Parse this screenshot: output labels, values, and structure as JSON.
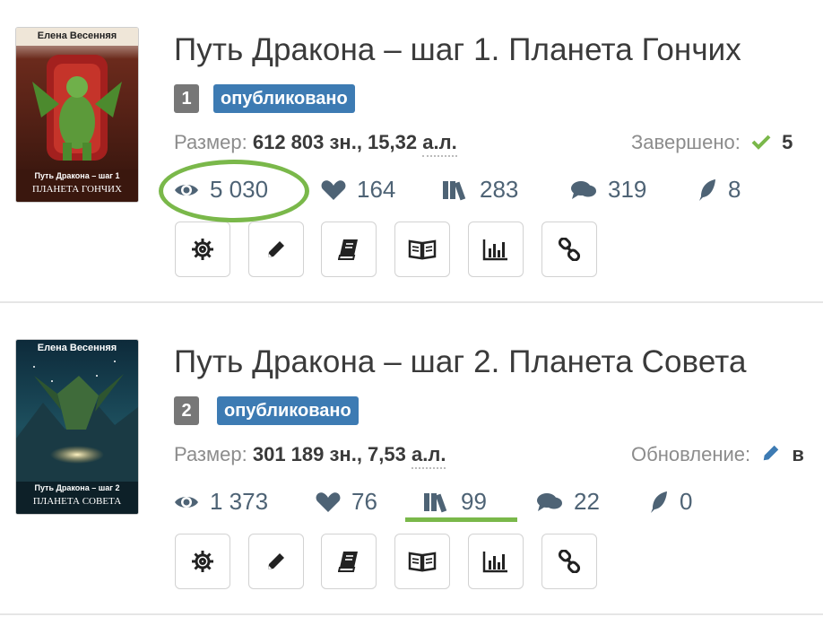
{
  "books": [
    {
      "cover": {
        "author": "Елена Весенняя",
        "subtitle": "Путь Дракона – шаг 1",
        "name": "ПЛАНЕТА ГОНЧИХ"
      },
      "title": "Путь Дракона – шаг 1. Планета Гончих",
      "number": "1",
      "status": "опубликовано",
      "size_label": "Размер:",
      "size_value": "612 803 зн., 15,32",
      "size_unit": "а.л.",
      "state_label": "Завершено:",
      "state_value": "5",
      "stats": {
        "views": "5 030",
        "likes": "164",
        "library": "283",
        "comments": "319",
        "rewards": "8"
      }
    },
    {
      "cover": {
        "author": "Елена Весенняя",
        "subtitle": "Путь Дракона – шаг 2",
        "name": "ПЛАНЕТА СОВЕТА"
      },
      "title": "Путь Дракона – шаг 2. Планета Совета",
      "number": "2",
      "status": "опубликовано",
      "size_label": "Размер:",
      "size_value": "301 189 зн., 7,53",
      "size_unit": "а.л.",
      "state_label": "Обновление:",
      "state_value": "в",
      "stats": {
        "views": "1 373",
        "likes": "76",
        "library": "99",
        "comments": "22",
        "rewards": "0"
      }
    }
  ],
  "icons": {
    "views": "eye-icon",
    "likes": "heart-icon",
    "library": "library-icon",
    "comments": "comments-icon",
    "rewards": "feather-icon",
    "buttons": [
      "gear-icon",
      "pencil-icon",
      "book-icon",
      "open-book-icon",
      "chart-icon",
      "link-icon"
    ]
  },
  "colors": {
    "status": "#3d7bb3",
    "number": "#777777",
    "stat": "#4e6375",
    "check": "#7ab84a",
    "highlight": "#7ab84a"
  }
}
